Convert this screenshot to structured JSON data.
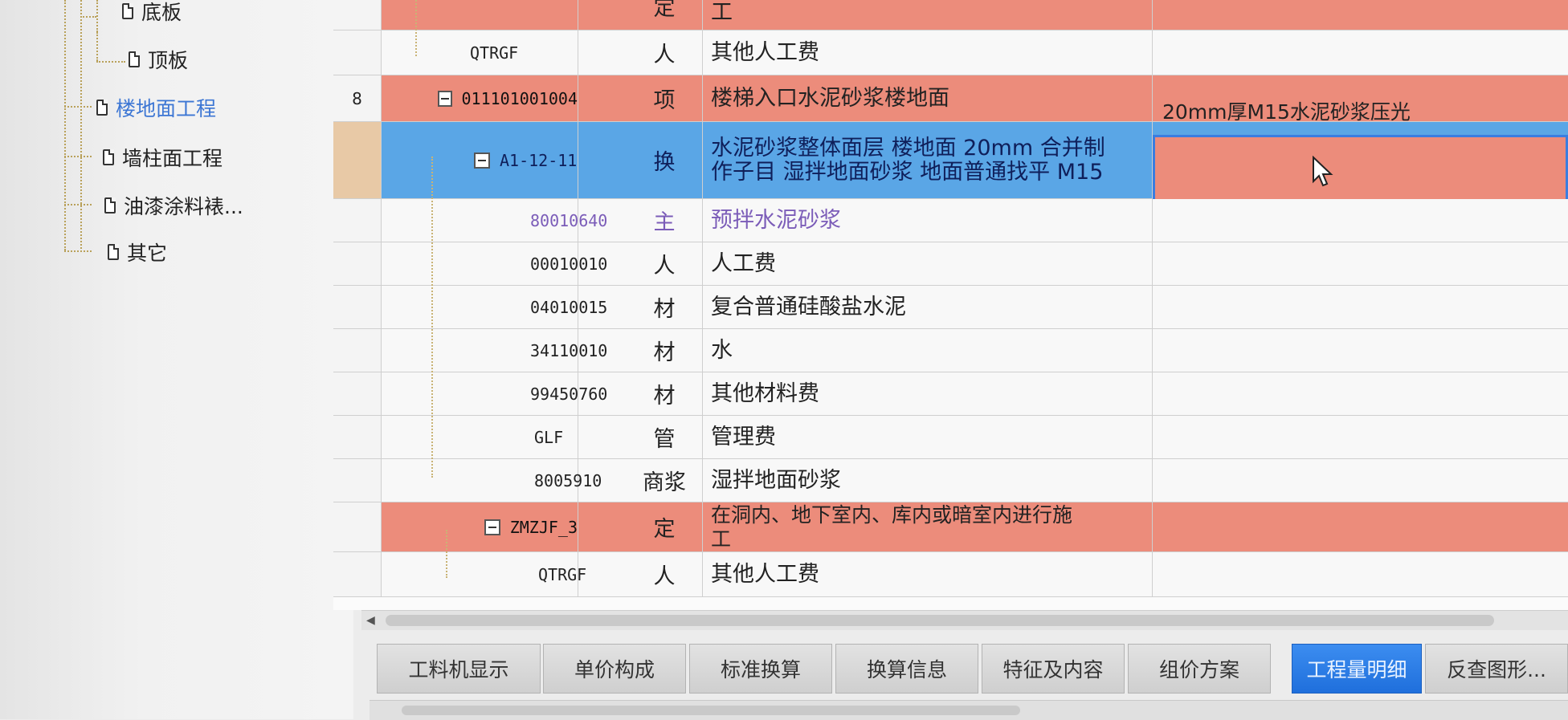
{
  "tree": {
    "items": [
      {
        "label": "底板",
        "active": false
      },
      {
        "label": "顶板",
        "active": false
      },
      {
        "label": "楼地面工程",
        "active": true
      },
      {
        "label": "墙柱面工程",
        "active": false
      },
      {
        "label": "油漆涂料裱...",
        "active": false
      },
      {
        "label": "其它",
        "active": false
      }
    ]
  },
  "grid": {
    "rows": [
      {
        "idx": "",
        "code": "",
        "type": "定",
        "name": "工",
        "feature": ""
      },
      {
        "idx": "",
        "code": "QTRGF",
        "type": "人",
        "name": "其他人工费",
        "feature": ""
      },
      {
        "idx": "8",
        "code": "011101001004",
        "type": "项",
        "name": "楼梯入口水泥砂浆楼地面",
        "feature": "20mm厚M15水泥砂浆压光"
      },
      {
        "idx": "",
        "code": "A1-12-11",
        "type": "换",
        "name_line1": "水泥砂浆整体面层 楼地面 20mm  合并制",
        "name_line2": "作子目 湿拌地面砂浆 地面普通找平 M15",
        "feature": ""
      },
      {
        "idx": "",
        "code": "80010640",
        "type": "主",
        "name": "预拌水泥砂浆",
        "feature": ""
      },
      {
        "idx": "",
        "code": "00010010",
        "type": "人",
        "name": "人工费",
        "feature": ""
      },
      {
        "idx": "",
        "code": "04010015",
        "type": "材",
        "name": "复合普通硅酸盐水泥",
        "feature": ""
      },
      {
        "idx": "",
        "code": "34110010",
        "type": "材",
        "name": "水",
        "feature": ""
      },
      {
        "idx": "",
        "code": "99450760",
        "type": "材",
        "name": "其他材料费",
        "feature": ""
      },
      {
        "idx": "",
        "code": "GLF",
        "type": "管",
        "name": "管理费",
        "feature": ""
      },
      {
        "idx": "",
        "code": "8005910",
        "type": "商浆",
        "name": "湿拌地面砂浆",
        "feature": ""
      },
      {
        "idx": "",
        "code": "ZMZJF_3",
        "type": "定",
        "name_line1": "在洞内、地下室内、库内或暗室内进行施",
        "name_line2": "工",
        "feature": ""
      },
      {
        "idx": "",
        "code": "QTRGF",
        "type": "人",
        "name": "其他人工费",
        "feature": ""
      }
    ]
  },
  "tabs": [
    {
      "label": "工料机显示"
    },
    {
      "label": "单价构成"
    },
    {
      "label": "标准换算"
    },
    {
      "label": "换算信息"
    },
    {
      "label": "特征及内容"
    },
    {
      "label": "组价方案"
    },
    {
      "label": "工程量明细",
      "active": true
    },
    {
      "label": "反查图形..."
    }
  ],
  "colors": {
    "salmon_row": "#ec8c7b",
    "selected_row": "#5aa6e6",
    "active_tab": "#2a7ce6",
    "tree_active": "#3c76d4"
  }
}
